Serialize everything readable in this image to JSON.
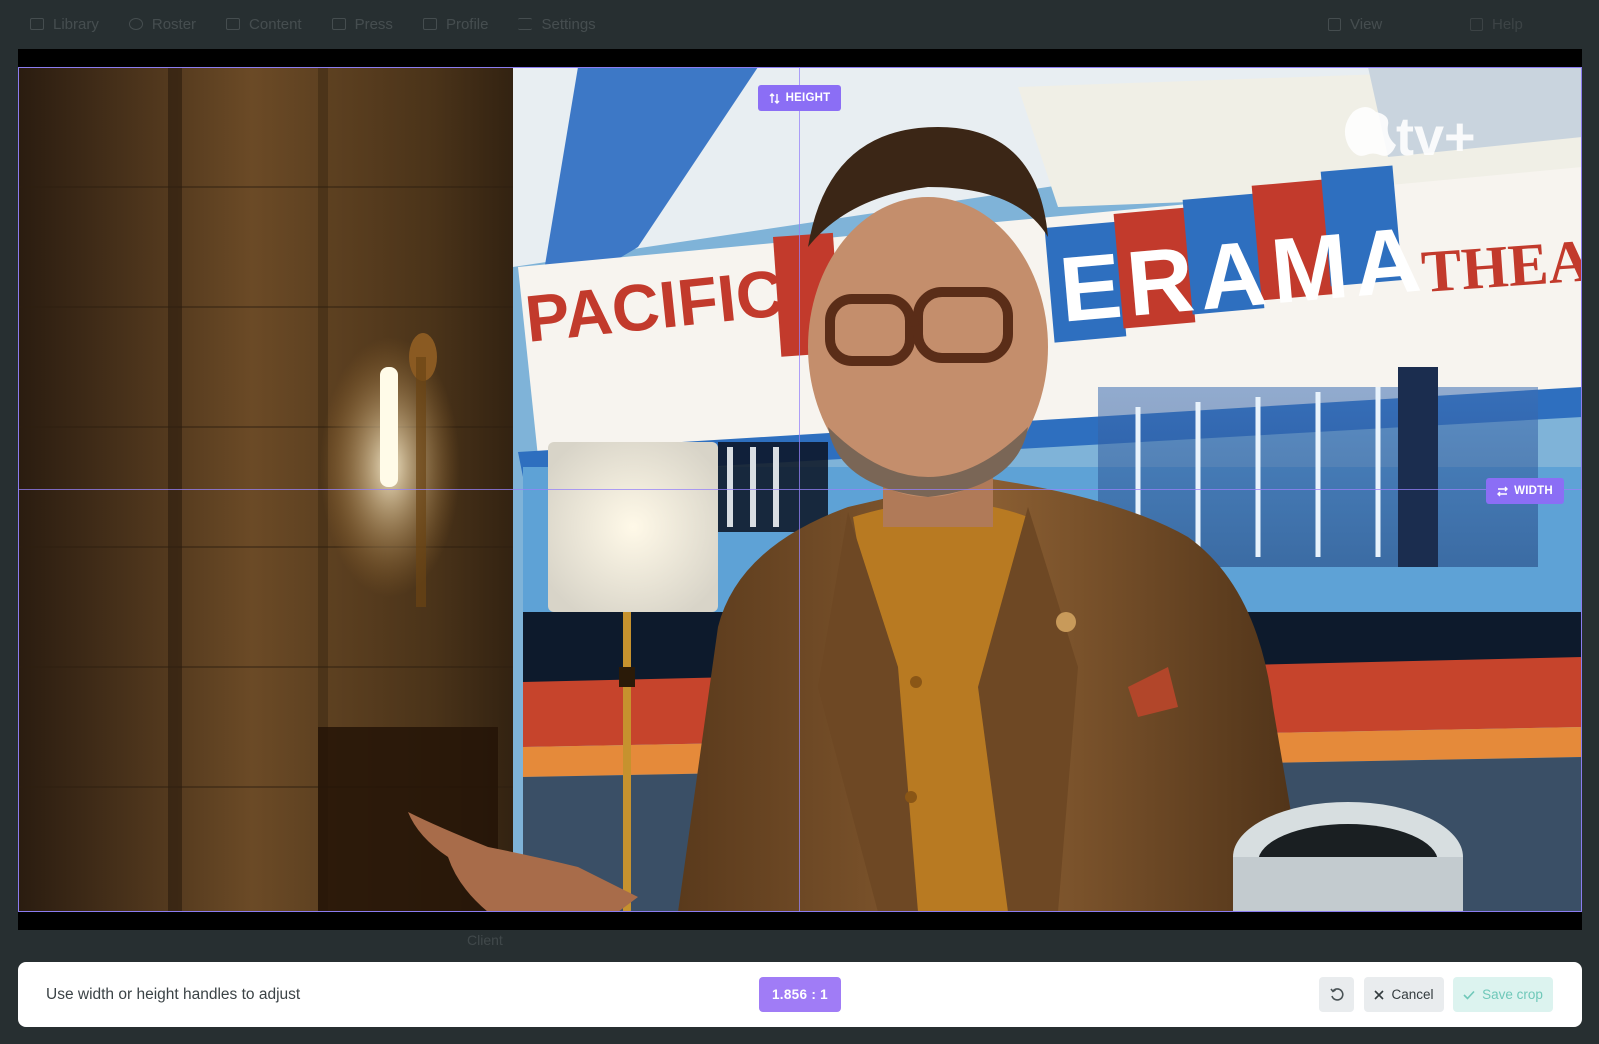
{
  "nav": {
    "items": [
      {
        "label": "Library",
        "icon": "library-icon"
      },
      {
        "label": "Roster",
        "icon": "roster-icon"
      },
      {
        "label": "Content",
        "icon": "content-icon"
      },
      {
        "label": "Press",
        "icon": "press-icon"
      },
      {
        "label": "Profile",
        "icon": "profile-icon"
      },
      {
        "label": "Settings",
        "icon": "settings-icon"
      }
    ],
    "view_label": "View",
    "help_label": "Help"
  },
  "image": {
    "description_alt": "Man in glasses and tan suit in front of a Pacific's Cinerama Theatre painting",
    "sign_left": "PACIFIC'S",
    "sign_center": "ERAMA",
    "sign_right": "THEATR",
    "watermark": "tv+"
  },
  "handles": {
    "height_label": "HEIGHT",
    "width_label": "WIDTH"
  },
  "under_label": "Client",
  "toolbar": {
    "hint": "Use width or height handles to adjust",
    "ratio": "1.856 : 1",
    "cancel_label": "Cancel",
    "save_label": "Save crop"
  },
  "colors": {
    "accent": "#8b6ef5",
    "ratio_bg": "#a07cf6",
    "save_bg": "#dcf3ef",
    "save_text": "#6fc8b9",
    "backdrop": "#272f31"
  }
}
